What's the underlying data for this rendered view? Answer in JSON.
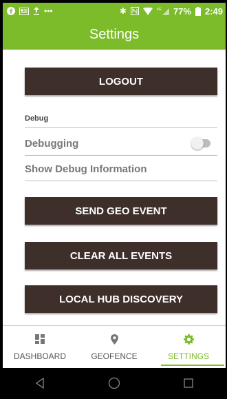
{
  "status_bar": {
    "left_icons": [
      "facebook-icon",
      "news-icon",
      "upload-icon",
      "more-dots-icon"
    ],
    "battery_percent": "77%",
    "time": "2:49"
  },
  "app_bar": {
    "title": "Settings"
  },
  "settings": {
    "logout_label": "LOGOUT",
    "debug_section_label": "Debug",
    "debugging_label": "Debugging",
    "debugging_enabled": false,
    "show_debug_label": "Show Debug Information",
    "send_geo_event_label": "SEND GEO EVENT",
    "clear_all_events_label": "CLEAR ALL EVENTS",
    "local_hub_discovery_label": "LOCAL HUB DISCOVERY"
  },
  "bottom_nav": {
    "items": [
      {
        "label": "DASHBOARD",
        "icon": "dashboard-icon",
        "active": false
      },
      {
        "label": "GEOFENCE",
        "icon": "location-pin-icon",
        "active": false
      },
      {
        "label": "SETTINGS",
        "icon": "gear-icon",
        "active": true
      }
    ]
  },
  "colors": {
    "accent": "#7cbb2a",
    "button": "#3e2f2a"
  }
}
